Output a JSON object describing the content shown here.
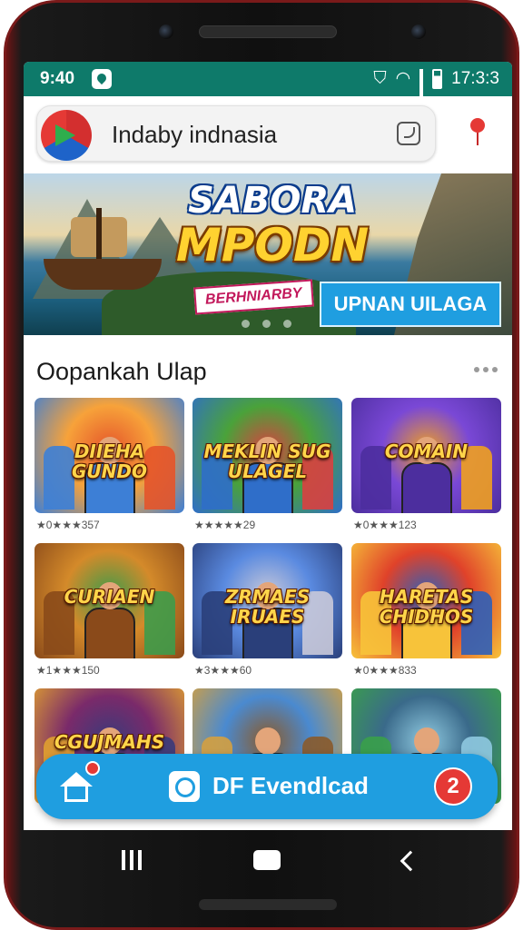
{
  "status_bar": {
    "time": "9:40",
    "battery_text": "17:3:3"
  },
  "search": {
    "query": "Indaby indnasia"
  },
  "banner": {
    "title_line1": "SABORA",
    "title_line2": "MPODN",
    "subtitle": "BERHNIARBY",
    "cta_label": "UPNAN UILAGA"
  },
  "section": {
    "title": "Oopankah Ulap"
  },
  "games": [
    {
      "title": "DIIEHA GUNDO",
      "rating": "★0★★★357",
      "palette": [
        "#f7a23a",
        "#3d7fd6",
        "#e4542a"
      ]
    },
    {
      "title": "MEKLIN SUG ULAGEL",
      "rating": "★★★★★29",
      "palette": [
        "#4aa23a",
        "#2f6ec9",
        "#d94040"
      ]
    },
    {
      "title": "COMAIN",
      "rating": "★0★★★123",
      "palette": [
        "#7a48d6",
        "#4c2e9e",
        "#f0a020"
      ]
    },
    {
      "title": "CURIAEN",
      "rating": "★1★★★150",
      "palette": [
        "#d48a2a",
        "#8a4a1a",
        "#3e9b4a"
      ]
    },
    {
      "title": "ZRMAES IRUAES",
      "rating": "★3★★★60",
      "palette": [
        "#5a8ae0",
        "#2a3f7a",
        "#c9c9d9"
      ]
    },
    {
      "title": "HARETAS CHIDHOS",
      "rating": "★0★★★833",
      "palette": [
        "#e0422a",
        "#f7c33a",
        "#2f5fb8"
      ]
    },
    {
      "title": "CGUJMAHS",
      "rating": "",
      "palette": [
        "#7a2a6a",
        "#e0a030",
        "#3a3a7a"
      ]
    },
    {
      "title": "",
      "rating": "",
      "palette": [
        "#4a8ad0",
        "#d4a040",
        "#8a5a2a"
      ]
    },
    {
      "title": "",
      "rating": "",
      "palette": [
        "#3a6a8a",
        "#3aa04a",
        "#8fc9e0"
      ]
    }
  ],
  "bottom_action": {
    "label": "DF Evendlcad",
    "badge": "2"
  },
  "colors": {
    "status_bar": "#0e7a6a",
    "accent": "#1f9ee0",
    "badge": "#e53935"
  }
}
